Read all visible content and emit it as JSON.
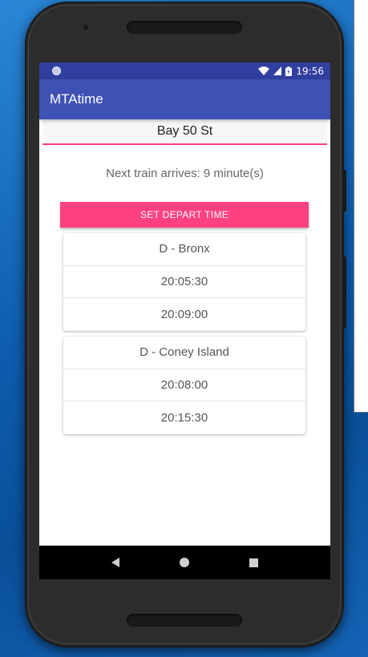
{
  "status_bar": {
    "time": "19:56",
    "icons": [
      "notification-dot-icon",
      "wifi-icon",
      "cellular-signal-icon",
      "battery-icon"
    ]
  },
  "app_bar": {
    "title": "MTAtime"
  },
  "station": {
    "value": "Bay 50 St"
  },
  "next_train": {
    "text": "Next train arrives: 9 minute(s)"
  },
  "depart_button": {
    "label": "SET DEPART TIME"
  },
  "directions": [
    {
      "name": "D - Bronx",
      "times": [
        "20:05:30",
        "20:09:00"
      ]
    },
    {
      "name": "D - Coney Island",
      "times": [
        "20:08:00",
        "20:15:30"
      ]
    }
  ],
  "nav_bar": {
    "buttons": [
      "back-icon",
      "home-icon",
      "recents-icon"
    ]
  },
  "colors": {
    "primary": "#3f51b5",
    "primary_dark": "#303f9f",
    "accent": "#ff4081"
  }
}
